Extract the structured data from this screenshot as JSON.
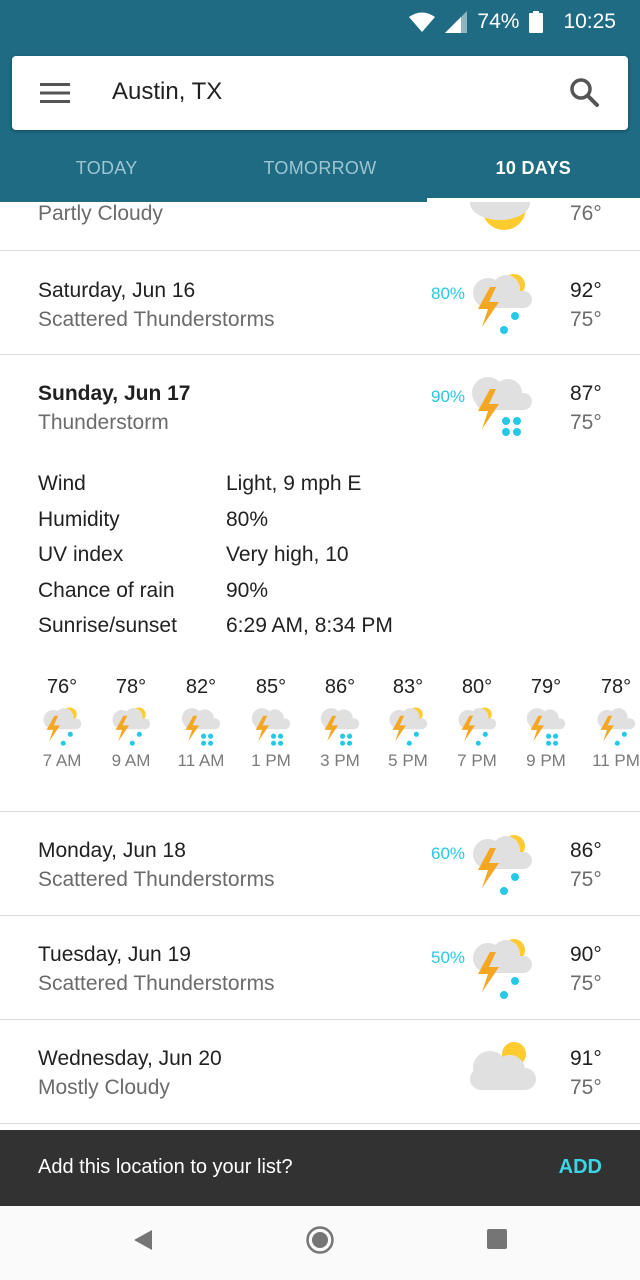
{
  "status_bar": {
    "battery": "74%",
    "time": "10:25"
  },
  "search": {
    "location": "Austin, TX",
    "menu_icon": "menu-icon",
    "search_icon": "search-icon"
  },
  "tabs": [
    {
      "label": "TODAY",
      "active": false
    },
    {
      "label": "TOMORROW",
      "active": false
    },
    {
      "label": "10 DAYS",
      "active": true
    }
  ],
  "partial_row": {
    "condition": "Partly Cloudy",
    "low": "76°",
    "icon": "partly-cloudy-icon"
  },
  "days": [
    {
      "date": "Saturday, Jun 16",
      "condition": "Scattered Thunderstorms",
      "precip": "80%",
      "high": "92°",
      "low": "75°",
      "icon": "scattered-thunderstorms-icon"
    },
    {
      "date": "Sunday, Jun 17",
      "condition": "Thunderstorm",
      "precip": "90%",
      "high": "87°",
      "low": "75°",
      "icon": "thunderstorm-icon"
    },
    {
      "date": "Monday, Jun 18",
      "condition": "Scattered Thunderstorms",
      "precip": "60%",
      "high": "86°",
      "low": "75°",
      "icon": "scattered-thunderstorms-icon"
    },
    {
      "date": "Tuesday, Jun 19",
      "condition": "Scattered Thunderstorms",
      "precip": "50%",
      "high": "90°",
      "low": "75°",
      "icon": "scattered-thunderstorms-icon"
    },
    {
      "date": "Wednesday, Jun 20",
      "condition": "Mostly Cloudy",
      "precip": "",
      "high": "91°",
      "low": "75°",
      "icon": "mostly-cloudy-icon"
    }
  ],
  "details": {
    "wind_label": "Wind",
    "wind": "Light, 9 mph E",
    "humidity_label": "Humidity",
    "humidity": "80%",
    "uv_label": "UV index",
    "uv": "Very high, 10",
    "rain_label": "Chance of rain",
    "rain": "90%",
    "sun_label": "Sunrise/sunset",
    "sun": "6:29 AM, 8:34 PM"
  },
  "hourly": [
    {
      "temp": "76°",
      "time": "7 AM",
      "icon": "scattered-thunderstorms-icon"
    },
    {
      "temp": "78°",
      "time": "9 AM",
      "icon": "scattered-thunderstorms-icon"
    },
    {
      "temp": "82°",
      "time": "11 AM",
      "icon": "thunderstorm-icon"
    },
    {
      "temp": "85°",
      "time": "1 PM",
      "icon": "thunderstorm-icon"
    },
    {
      "temp": "86°",
      "time": "3 PM",
      "icon": "thunderstorm-icon"
    },
    {
      "temp": "83°",
      "time": "5 PM",
      "icon": "scattered-thunderstorms-icon"
    },
    {
      "temp": "80°",
      "time": "7 PM",
      "icon": "scattered-thunderstorms-icon"
    },
    {
      "temp": "79°",
      "time": "9 PM",
      "icon": "thunderstorm-icon"
    },
    {
      "temp": "78°",
      "time": "11 PM",
      "icon": "night-thunderstorm-icon"
    }
  ],
  "snackbar": {
    "message": "Add this location to your list?",
    "action": "ADD"
  },
  "colors": {
    "appbar": "#1e6b83",
    "accent": "#24c9e6",
    "bolt": "#f5a623",
    "sun": "#ffcb2f",
    "cloud": "#e0e0e0"
  }
}
